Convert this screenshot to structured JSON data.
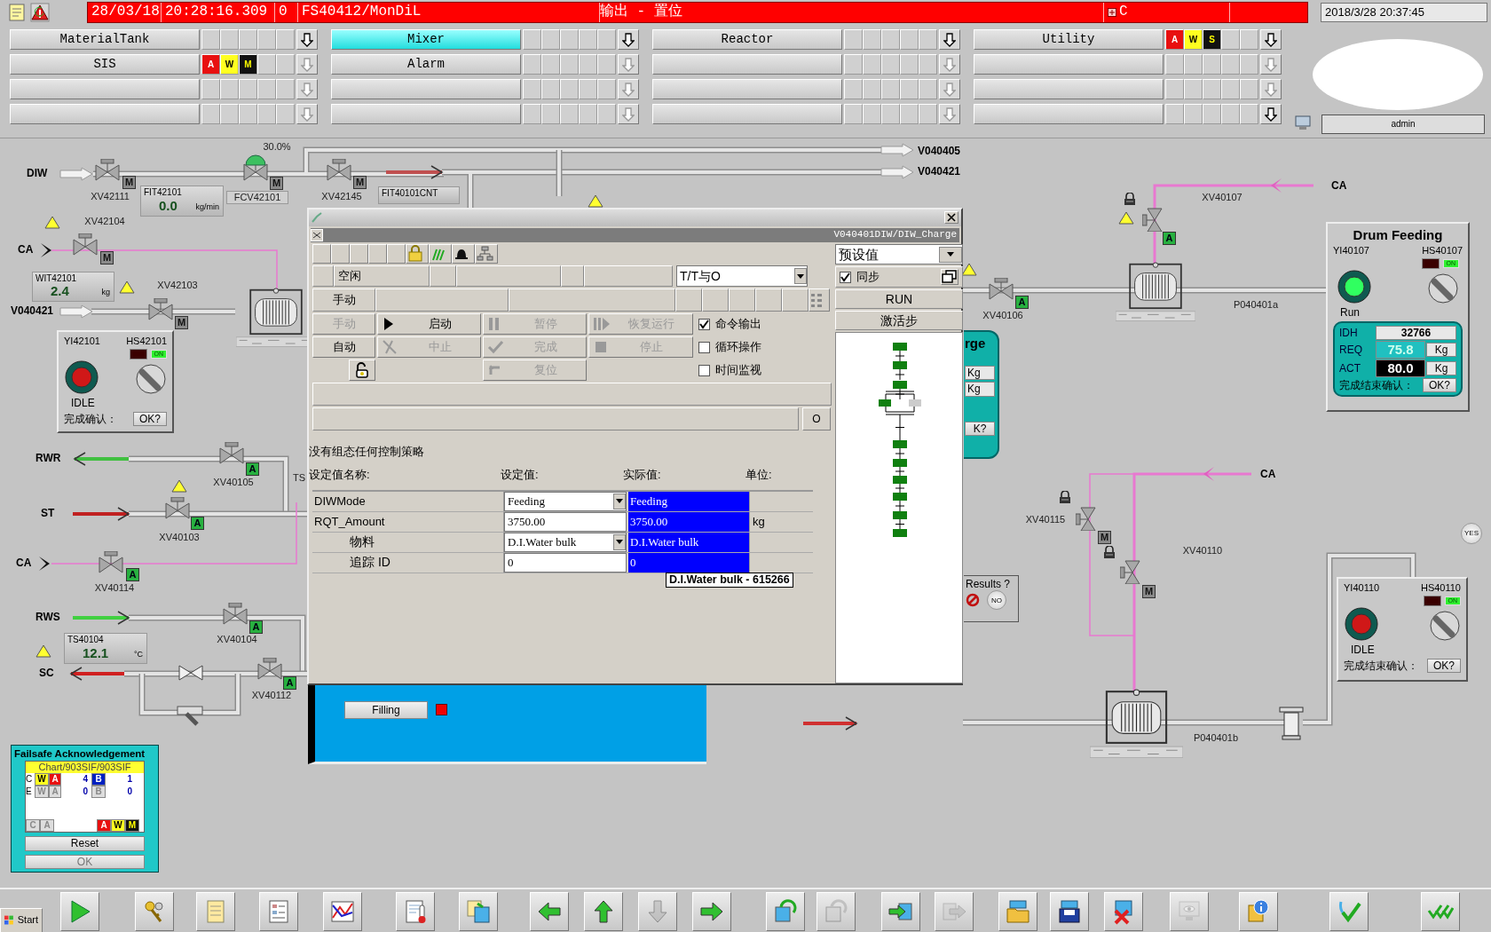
{
  "header": {
    "date": "28/03/18",
    "time": "20:28:16.309",
    "count": "0",
    "source": "FS40412/MonDiL",
    "message": "输出 - 置位",
    "flag": "C",
    "clock": "2018/3/28 20:37:45"
  },
  "areas": [
    {
      "label": "MaterialTank",
      "selected": false,
      "nav_enabled": true
    },
    {
      "label": "Mixer",
      "selected": true,
      "nav_enabled": true
    },
    {
      "label": "Reactor",
      "selected": false,
      "nav_enabled": true
    },
    {
      "label": "Utility",
      "selected": false,
      "nav_enabled": true,
      "alarms": [
        {
          "letter": "A",
          "kind": "alarm"
        },
        {
          "letter": "W",
          "kind": "warning"
        },
        {
          "letter": "S",
          "kind": "maintenance"
        }
      ]
    },
    {
      "label": "SIS",
      "selected": false,
      "nav_enabled": false,
      "alarms": [
        {
          "letter": "A",
          "kind": "alarm"
        },
        {
          "letter": "W",
          "kind": "warning"
        },
        {
          "letter": "M",
          "kind": "maintenance"
        }
      ]
    },
    {
      "label": "Alarm",
      "selected": false,
      "nav_enabled": false
    },
    {
      "selected": false,
      "nav_enabled": false
    },
    {
      "selected": false,
      "nav_enabled": false
    },
    {
      "selected": false,
      "nav_enabled": false
    },
    {
      "selected": false,
      "nav_enabled": false
    },
    {
      "selected": false,
      "nav_enabled": false
    },
    {
      "selected": false,
      "nav_enabled": false
    },
    {
      "selected": false,
      "nav_enabled": false
    },
    {
      "selected": false,
      "nav_enabled": false
    },
    {
      "selected": false,
      "nav_enabled": false
    },
    {
      "selected": false,
      "nav_enabled": true
    }
  ],
  "user": "admin",
  "plant": {
    "streams": [
      "DIW",
      "CA",
      "V040421",
      "RWR",
      "ST",
      "CA",
      "RWS",
      "SC",
      "V040405",
      "V040421",
      "CA",
      "CA"
    ],
    "cut_label": "TS",
    "valves": [
      {
        "tag": "XV42111",
        "mode": "M",
        "auto": false
      },
      {
        "tag": "XV42145",
        "mode": "M",
        "auto": false
      },
      {
        "tag": "XV42104",
        "mode": "M",
        "auto": false
      },
      {
        "tag": "XV42103",
        "mode": "M",
        "auto": false
      },
      {
        "tag": "XV40105",
        "mode": "A",
        "auto": true
      },
      {
        "tag": "XV40103",
        "mode": "A",
        "auto": true
      },
      {
        "tag": "XV40114",
        "mode": "A",
        "auto": true
      },
      {
        "tag": "XV40104",
        "mode": "A",
        "auto": true
      },
      {
        "tag": "XV40112",
        "mode": "A",
        "auto": true
      },
      {
        "tag": "XV40106",
        "mode": "A",
        "auto": true
      },
      {
        "tag": "XV40107",
        "mode": "A",
        "auto": true
      },
      {
        "tag": "XV40115",
        "mode": "M",
        "auto": false
      },
      {
        "tag": "XV40110",
        "mode": "M",
        "auto": false
      }
    ],
    "control_valve": {
      "tag": "FCV42101",
      "output": "30.0%",
      "mode": "M",
      "auto": false
    },
    "meters": [
      {
        "tag": "FIT42101",
        "value": "0.0",
        "unit": "kg/min"
      },
      {
        "tag": "WIT42101",
        "value": "2.4",
        "unit": "kg"
      },
      {
        "tag": "TS40104",
        "value": "12.1",
        "unit": "°C"
      }
    ],
    "counter": {
      "tag": "FIT40101CNT"
    },
    "pumps": [
      {
        "tag": "P040401a"
      },
      {
        "tag": "P040401b"
      }
    ],
    "motor_panels": [
      {
        "indicator": "YI42101",
        "switch": "HS42101",
        "running": false,
        "state": "IDLE",
        "switch_on": true,
        "on_label": "ON",
        "confirm": "完成确认：",
        "ok": "OK?"
      },
      {
        "indicator": "YI40110",
        "switch": "HS40110",
        "running": false,
        "state": "IDLE",
        "switch_on": true,
        "on_label": "ON",
        "confirm": "完成结束确认：",
        "ok": "OK?"
      }
    ],
    "drum_feeding": {
      "title": "Drum Feeding",
      "indicator": "YI40107",
      "switch": "HS40107",
      "running": true,
      "state": "Run",
      "switch_on": true,
      "on_label": "ON",
      "fields": [
        {
          "label": "IDH",
          "value": "32766",
          "kind": "text"
        },
        {
          "label": "REQ",
          "value": "75.8",
          "unit": "Kg",
          "kind": "req"
        },
        {
          "label": "ACT",
          "value": "80.0",
          "unit": "Kg",
          "kind": "act"
        }
      ],
      "confirm": "完成结束确认：",
      "ok": "OK?"
    },
    "yes_button": "YES",
    "filling_panel": {
      "button": "Filling",
      "alarm": true
    },
    "charge_panel": {
      "title": "rge",
      "units": [
        "Kg",
        "Kg"
      ],
      "ok": "K?"
    },
    "results": {
      "label": "Results ?",
      "no": "NO"
    }
  },
  "faceplate": {
    "path": "V040401DIW/DIW_Charge",
    "view": "预设值",
    "status": "空闲",
    "mode": "手动",
    "display_option": "T/T与O",
    "sync": {
      "label": "同步",
      "checked": true
    },
    "run_state": "RUN",
    "active_step_label": "激活步",
    "commands": [
      {
        "label": "手动",
        "kind": "text",
        "disabled": true
      },
      {
        "label": "启动",
        "kind": "start",
        "disabled": false
      },
      {
        "label": "暂停",
        "kind": "pause",
        "disabled": true
      },
      {
        "label": "恢复运行",
        "kind": "resume",
        "disabled": true
      },
      {
        "label": "自动",
        "kind": "text",
        "disabled": false
      },
      {
        "label": "中止",
        "kind": "abort",
        "disabled": true
      },
      {
        "label": "完成",
        "kind": "complete",
        "disabled": true
      },
      {
        "label": "停止",
        "kind": "stop",
        "disabled": true
      },
      {
        "kind": "unlock",
        "disabled": false
      },
      {
        "label": "复位",
        "kind": "reset",
        "disabled": true
      }
    ],
    "options": [
      {
        "label": "命令输出",
        "checked": true
      },
      {
        "label": "循环操作",
        "checked": false
      },
      {
        "label": "时间监视",
        "checked": false
      }
    ],
    "counter_button": "O",
    "message": "没有组态任何控制策略",
    "columns": [
      "设定值名称:",
      "设定值:",
      "实际值:",
      "单位:"
    ],
    "rows": [
      {
        "name": "DIWMode",
        "setpoint": "Feeding",
        "actual": "Feeding",
        "kind": "select"
      },
      {
        "name": "RQT_Amount",
        "setpoint": "3750.00",
        "actual": "3750.00",
        "unit": "kg",
        "kind": "input",
        "children": [
          {
            "name": "物料",
            "setpoint": "D.I.Water bulk",
            "actual": "D.I.Water bulk",
            "kind": "select"
          },
          {
            "name": "追踪 ID",
            "setpoint": "0",
            "actual": "0",
            "kind": "input"
          }
        ]
      }
    ],
    "tooltip": "D.I.Water bulk - 615266"
  },
  "failsafe": {
    "title": "Failsafe Acknowledgement",
    "chart": "Chart/903SIF/903SIF",
    "rows": [
      {
        "label": "C",
        "w": "W",
        "a": "A",
        "a_count": "4",
        "b": "B",
        "b_count": "1",
        "active": true
      },
      {
        "label": "E",
        "w": "W",
        "a": "A",
        "a_count": "0",
        "b": "B",
        "b_count": "0",
        "active": false
      }
    ],
    "footer": [
      {
        "letter": "C",
        "kind": "plain"
      },
      {
        "letter": "A",
        "kind": "plain"
      },
      {
        "letter": "A",
        "kind": "alarm"
      },
      {
        "letter": "W",
        "kind": "warning"
      },
      {
        "letter": "M",
        "kind": "maintenance"
      }
    ],
    "reset": "Reset",
    "ok": "OK",
    "ok_disabled": true
  },
  "toolbar": {
    "start": "Start",
    "buttons": [
      {
        "kind": "play",
        "disabled": false
      },
      {
        "kind": "keys",
        "disabled": false
      },
      {
        "kind": "notes",
        "disabled": false
      },
      {
        "kind": "report",
        "disabled": false
      },
      {
        "kind": "trend",
        "disabled": false
      },
      {
        "kind": "thermometer",
        "disabled": false
      },
      {
        "kind": "copy",
        "disabled": false
      },
      {
        "kind": "left",
        "disabled": false
      },
      {
        "kind": "up",
        "disabled": false
      },
      {
        "kind": "down",
        "disabled": true
      },
      {
        "kind": "right",
        "disabled": false
      },
      {
        "kind": "rotate",
        "disabled": false
      },
      {
        "kind": "rotate",
        "disabled": true
      },
      {
        "kind": "import",
        "disabled": false
      },
      {
        "kind": "export",
        "disabled": true
      },
      {
        "kind": "open",
        "disabled": false
      },
      {
        "kind": "save",
        "disabled": false
      },
      {
        "kind": "delete",
        "disabled": false
      },
      {
        "kind": "monitor",
        "disabled": true
      },
      {
        "kind": "info",
        "disabled": false
      },
      {
        "kind": "check",
        "disabled": false
      },
      {
        "kind": "checkall",
        "disabled": false
      }
    ]
  }
}
